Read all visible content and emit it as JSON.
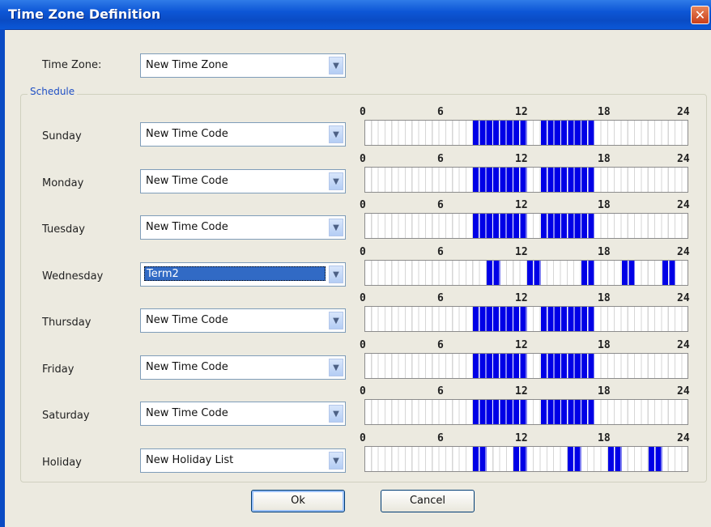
{
  "window": {
    "title": "Time Zone Definition",
    "close_label": "✕"
  },
  "time_zone": {
    "label": "Time Zone:",
    "value": "New Time Zone"
  },
  "schedule": {
    "legend": "Schedule",
    "ticks": [
      "0",
      "6",
      "12",
      "18",
      "24"
    ],
    "active_color": "#0000e6",
    "days": [
      {
        "label": "Sunday",
        "value": "New Time Code",
        "active_hours": [
          [
            8,
            12
          ],
          [
            13,
            17
          ]
        ]
      },
      {
        "label": "Monday",
        "value": "New Time Code",
        "active_hours": [
          [
            8,
            12
          ],
          [
            13,
            17
          ]
        ]
      },
      {
        "label": "Tuesday",
        "value": "New Time Code",
        "active_hours": [
          [
            8,
            12
          ],
          [
            13,
            17
          ]
        ]
      },
      {
        "label": "Wednesday",
        "value": "Term2",
        "active_hours": [
          [
            9,
            10
          ],
          [
            12,
            13
          ],
          [
            16,
            17
          ],
          [
            19,
            20
          ],
          [
            22,
            23
          ]
        ]
      },
      {
        "label": "Thursday",
        "value": "New Time Code",
        "active_hours": [
          [
            8,
            12
          ],
          [
            13,
            17
          ]
        ]
      },
      {
        "label": "Friday",
        "value": "New Time Code",
        "active_hours": [
          [
            8,
            12
          ],
          [
            13,
            17
          ]
        ]
      },
      {
        "label": "Saturday",
        "value": "New Time Code",
        "active_hours": [
          [
            8,
            12
          ],
          [
            13,
            17
          ]
        ]
      },
      {
        "label": "Holiday",
        "value": "New Holiday List",
        "active_hours": [
          [
            8,
            9
          ],
          [
            11,
            12
          ],
          [
            15,
            16
          ],
          [
            18,
            19
          ],
          [
            21,
            22
          ]
        ]
      }
    ]
  },
  "buttons": {
    "ok": "Ok",
    "cancel": "Cancel"
  }
}
